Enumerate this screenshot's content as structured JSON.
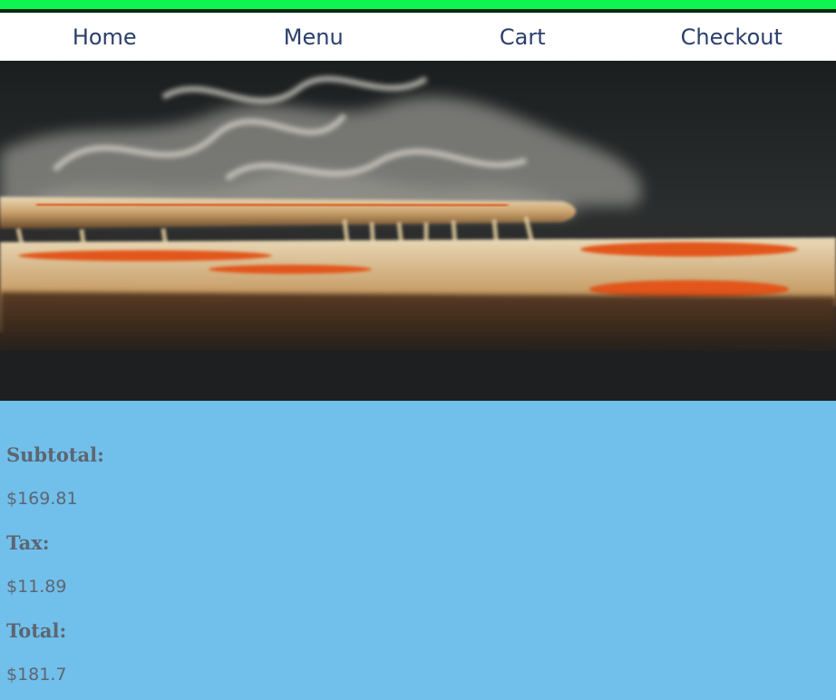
{
  "nav": {
    "items": [
      "Home",
      "Menu",
      "Cart",
      "Checkout"
    ]
  },
  "hero": {
    "image": "pizza-steam-photo"
  },
  "summary": {
    "subtotal_label": "Subtotal:",
    "subtotal_value": "$169.81",
    "tax_label": "Tax:",
    "tax_value": "$11.89",
    "total_label": "Total:",
    "total_value": "$181.7"
  },
  "colors": {
    "accent_bar": "#0cf550",
    "nav_text": "#2b3f6b",
    "page_background": "#71bfeb",
    "summary_text": "#5c6670"
  }
}
